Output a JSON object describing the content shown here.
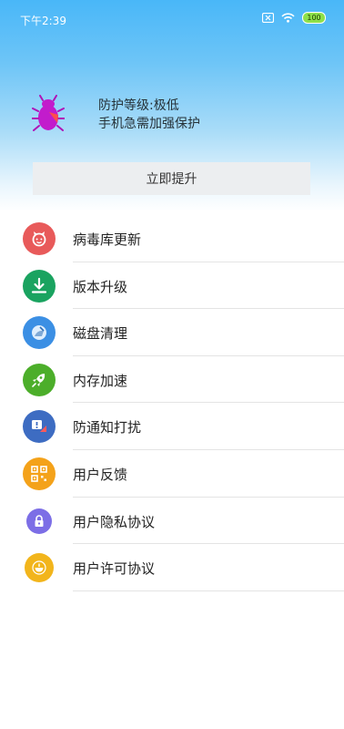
{
  "status_bar": {
    "time": "下午2:39",
    "battery": "100"
  },
  "protection": {
    "level_text": "防护等级:极低",
    "warning_text": "手机急需加强保护",
    "upgrade_label": "立即提升"
  },
  "menu": {
    "items": [
      {
        "label": "病毒库更新",
        "icon": "virus-icon",
        "color": "#e85a5a"
      },
      {
        "label": "版本升级",
        "icon": "download-icon",
        "color": "#1aa360"
      },
      {
        "label": "磁盘清理",
        "icon": "disk-icon",
        "color": "#3b8fe4"
      },
      {
        "label": "内存加速",
        "icon": "rocket-icon",
        "color": "#4cae2a"
      },
      {
        "label": "防通知打扰",
        "icon": "notification-block-icon",
        "color": "#3d6cc2"
      },
      {
        "label": "用户反馈",
        "icon": "qr-code-icon",
        "color": "#f4a21a"
      },
      {
        "label": "用户隐私协议",
        "icon": "lock-icon",
        "color": "#7c6ee6"
      },
      {
        "label": "用户许可协议",
        "icon": "cup-icon",
        "color": "#f2b51c"
      }
    ]
  }
}
